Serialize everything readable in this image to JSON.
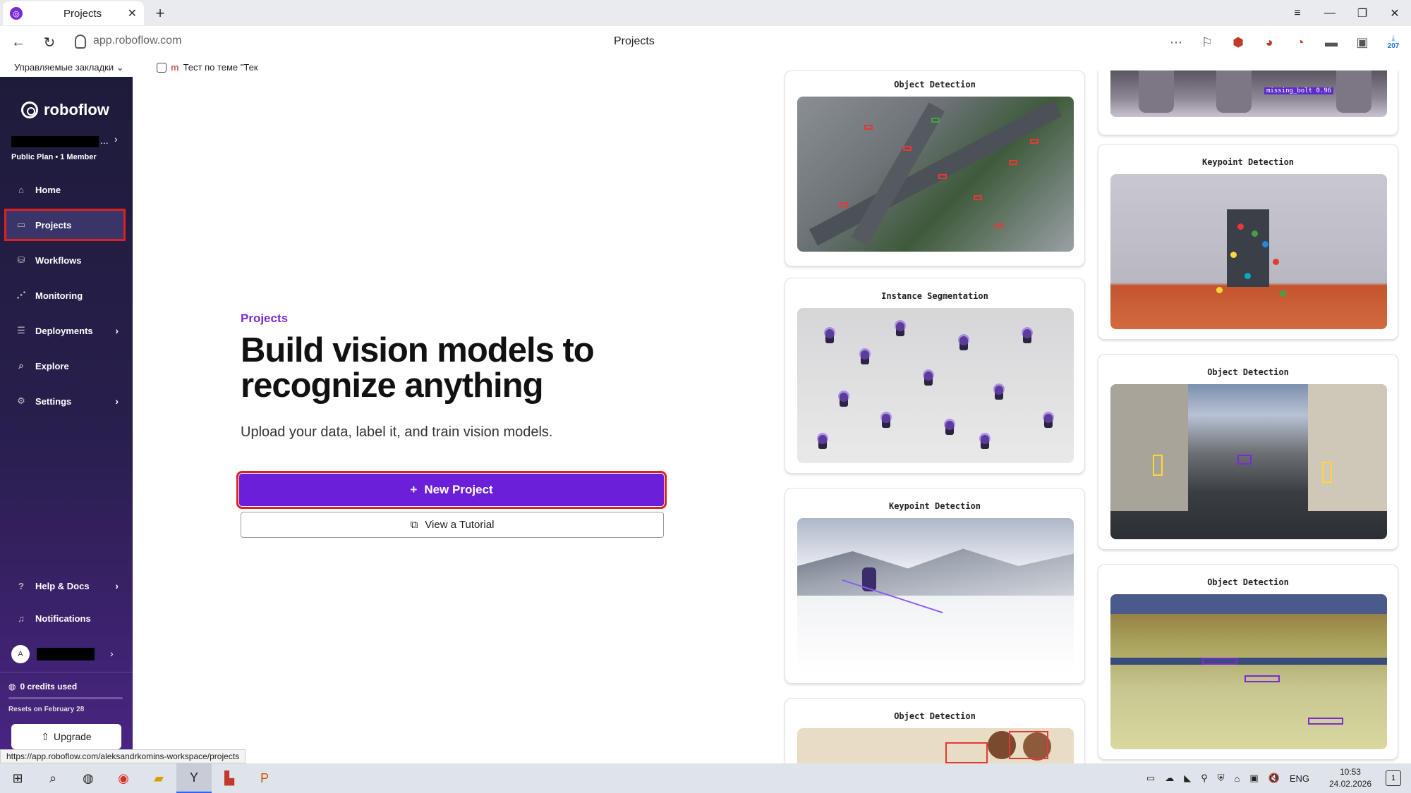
{
  "browser": {
    "tab_title": "Projects",
    "url": "app.roboflow.com",
    "page_title": "Projects",
    "bookmarks_folder": "Управляемые закладки",
    "bookmark_item": "Тест по теме \"Тек",
    "status_url": "https://app.roboflow.com/aleksandrkomins-workspace/projects",
    "badge_count": "207"
  },
  "sidebar": {
    "brand": "roboflow",
    "workspace_more": "...",
    "plan": "Public Plan • 1 Member",
    "items": [
      {
        "label": "Home",
        "icon": "home-icon"
      },
      {
        "label": "Projects",
        "icon": "projects-icon"
      },
      {
        "label": "Workflows",
        "icon": "workflows-icon"
      },
      {
        "label": "Monitoring",
        "icon": "monitoring-icon"
      },
      {
        "label": "Deployments",
        "icon": "deployments-icon"
      },
      {
        "label": "Explore",
        "icon": "explore-icon"
      },
      {
        "label": "Settings",
        "icon": "settings-icon"
      }
    ],
    "help_label": "Help & Docs",
    "notifications_label": "Notifications",
    "avatar_initial": "A",
    "credits": "0 credits used",
    "resets": "Resets on February 28",
    "upgrade_label": "Upgrade"
  },
  "hero": {
    "eyebrow": "Projects",
    "title": "Build vision models to recognize anything",
    "subtitle": "Upload your data, label it, and train vision models.",
    "new_project_label": "New Project",
    "tutorial_label": "View a Tutorial"
  },
  "gallery": {
    "col1": [
      "Object Detection",
      "Instance Segmentation",
      "Keypoint Detection",
      "Object Detection"
    ],
    "col2": [
      "Keypoint Detection",
      "Object Detection",
      "Object Detection"
    ],
    "top_label": "missing_bolt 0.96"
  },
  "taskbar": {
    "lang": "ENG",
    "time": "10:53",
    "date": "24.02.2026",
    "notif_count": "1"
  },
  "colors": {
    "accent": "#6a1fd8",
    "highlight": "#e02020"
  }
}
